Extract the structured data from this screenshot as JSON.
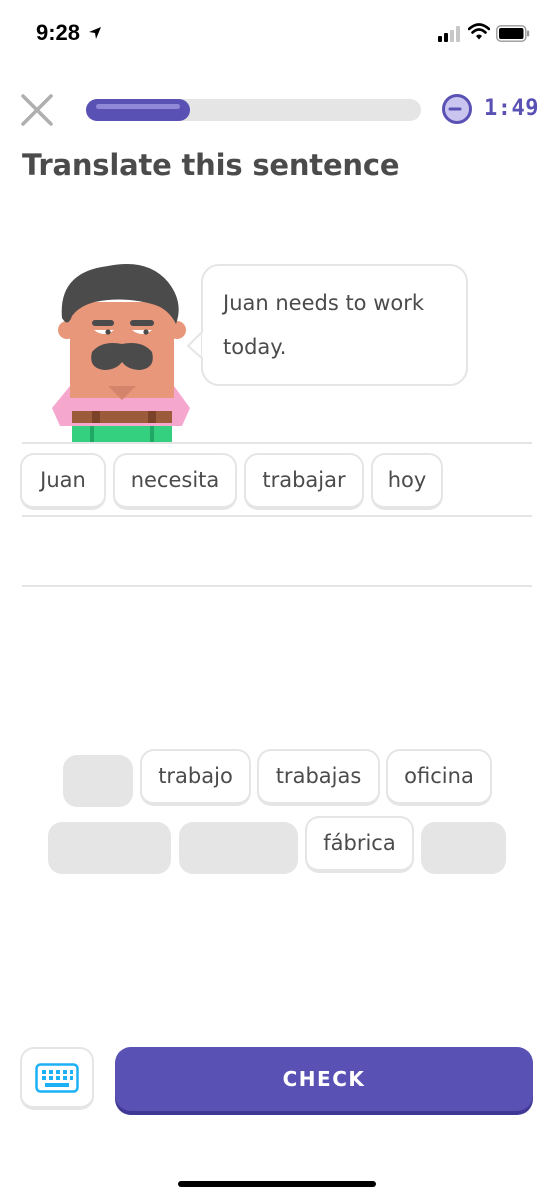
{
  "status_bar": {
    "time": "9:28"
  },
  "header": {
    "progress": 0.31,
    "timer": "1:49",
    "title": "Translate this sentence"
  },
  "prompt": {
    "lines": [
      "Juan needs to work",
      "today."
    ]
  },
  "answer_tiles": [
    "Juan",
    "necesita",
    "trabajar",
    "hoy"
  ],
  "word_bank": {
    "row1": [
      "trabajo",
      "trabajas",
      "oficina"
    ],
    "row2": [
      "fábrica"
    ]
  },
  "footer": {
    "check_label": "CHECK"
  },
  "colors": {
    "accent": "#5a51b5",
    "border": "#e5e5e5",
    "text": "#4b4b4b"
  }
}
